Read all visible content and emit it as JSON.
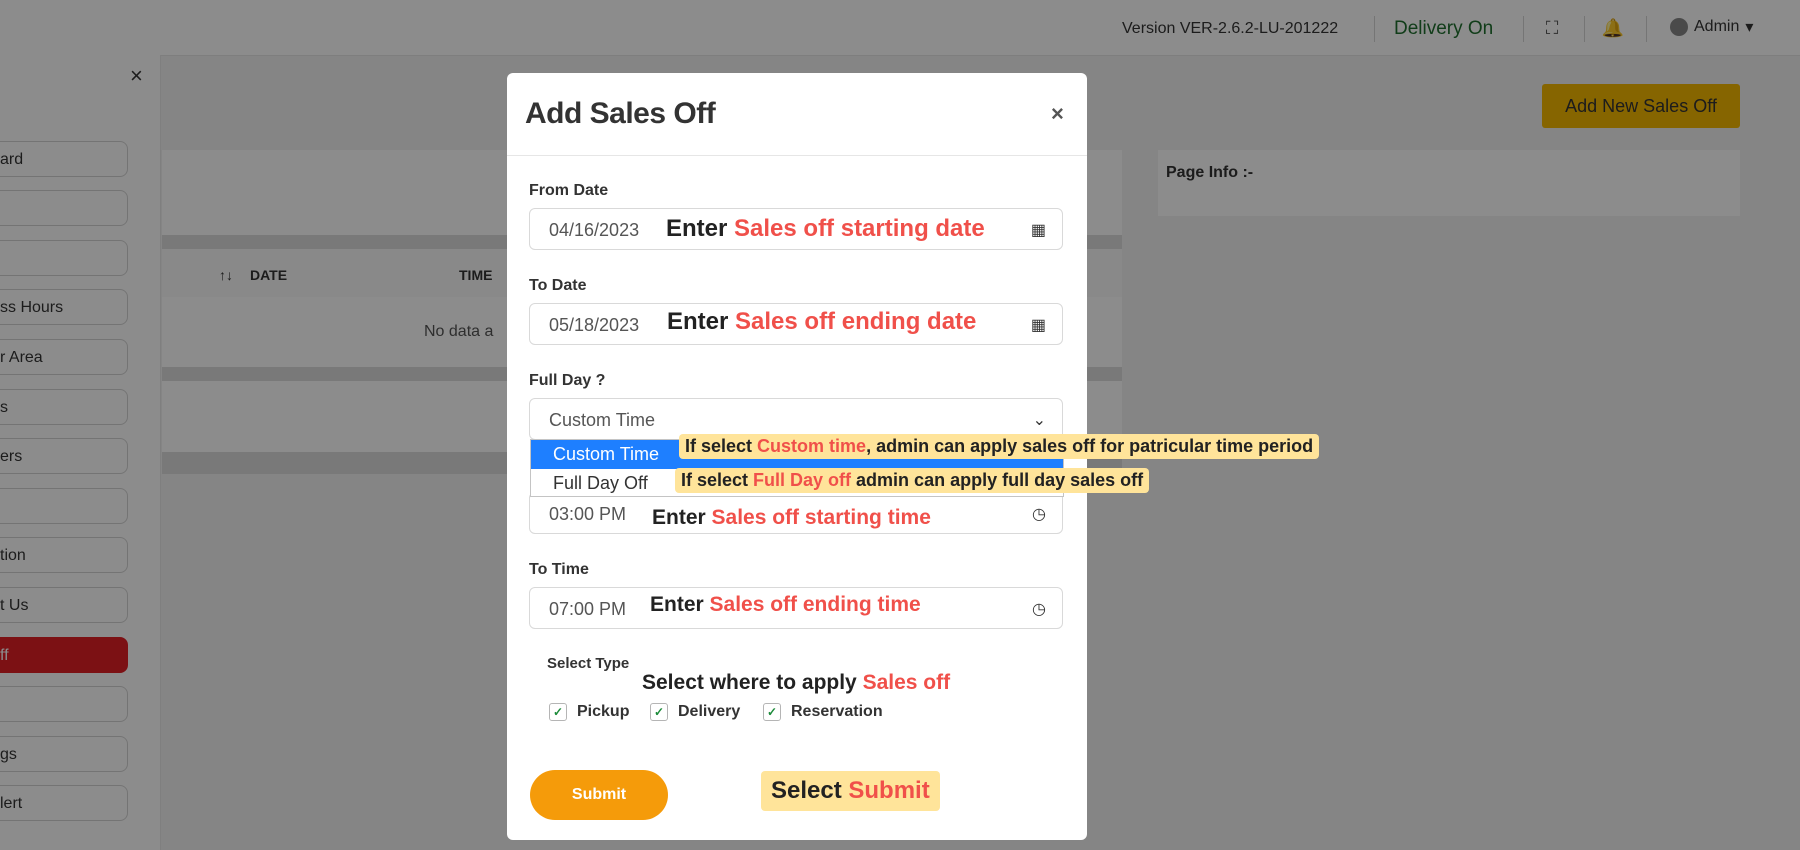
{
  "topbar": {
    "version": "Version VER-2.6.2-LU-201222",
    "delivery_status": "Delivery On",
    "fullscreen_icon": "fullscreen-icon",
    "bell_icon": "bell-icon",
    "admin_label": "Admin"
  },
  "sidebar": {
    "close": "×",
    "items": [
      {
        "label": "ard"
      },
      {
        "label": ""
      },
      {
        "label": ""
      },
      {
        "label": "ss Hours"
      },
      {
        "label": "r Area"
      },
      {
        "label": "s"
      },
      {
        "label": "ers"
      },
      {
        "label": ""
      },
      {
        "label": "tion"
      },
      {
        "label": "t Us"
      },
      {
        "label": "ff",
        "active": true
      },
      {
        "label": ""
      },
      {
        "label": "gs"
      },
      {
        "label": "lert"
      }
    ]
  },
  "main": {
    "add_new_label": "Add New Sales Off",
    "page_info_label": "Page Info :-",
    "table": {
      "sort_icon": "↑↓",
      "columns": [
        "DATE",
        "TIME"
      ],
      "empty_text": "No data a"
    }
  },
  "modal": {
    "title": "Add Sales Off",
    "close": "×",
    "from_date": {
      "label": "From Date",
      "value": "04/16/2023"
    },
    "to_date": {
      "label": "To Date",
      "value": "05/18/2023"
    },
    "full_day": {
      "label": "Full Day ?",
      "value": "Custom Time",
      "options": [
        "Custom Time",
        "Full Day Off"
      ]
    },
    "from_time": {
      "value": "03:00 PM"
    },
    "to_time": {
      "label": "To Time",
      "value": "07:00 PM"
    },
    "select_type": {
      "label": "Select Type",
      "options": [
        {
          "label": "Pickup",
          "checked": true
        },
        {
          "label": "Delivery",
          "checked": true
        },
        {
          "label": "Reservation",
          "checked": true
        }
      ]
    },
    "submit_label": "Submit"
  },
  "annotations": {
    "from_date": {
      "prefix": "Enter ",
      "highlight": "Sales off starting date"
    },
    "to_date": {
      "prefix": "Enter ",
      "highlight": "Sales off ending date"
    },
    "custom_time": {
      "prefix": "If select ",
      "highlight": "Custom time",
      "suffix": ", admin can apply sales off for patricular time period"
    },
    "full_day_off": {
      "prefix": "If select ",
      "highlight": "Full Day off",
      "suffix": "  admin can apply full day sales off"
    },
    "from_time": {
      "prefix": "Enter ",
      "highlight": "Sales off starting time"
    },
    "to_time": {
      "prefix": "Enter ",
      "highlight": "Sales off ending time"
    },
    "select_type": {
      "prefix": "Select where to apply ",
      "highlight": "Sales off"
    },
    "submit": {
      "prefix": "Select ",
      "highlight": "Submit"
    }
  }
}
